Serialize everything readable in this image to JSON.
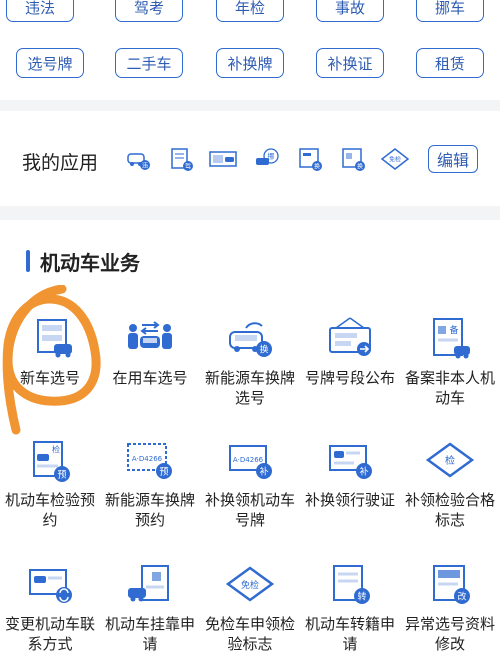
{
  "top_chips": [
    {
      "label": "违法"
    },
    {
      "label": "驾考"
    },
    {
      "label": "年检"
    },
    {
      "label": "事故"
    },
    {
      "label": "挪车"
    },
    {
      "label": "选号牌"
    },
    {
      "label": "二手车"
    },
    {
      "label": "补换牌"
    },
    {
      "label": "补换证"
    },
    {
      "label": "租赁"
    }
  ],
  "my_apps": {
    "label": "我的应用",
    "edit_label": "编辑",
    "mini_icons": [
      {
        "name": "violation-app-icon",
        "badge": "违"
      },
      {
        "name": "license-app-icon",
        "badge": "驾"
      },
      {
        "name": "plate-car-app-icon",
        "badge": ""
      },
      {
        "name": "move-car-app-icon",
        "badge": "挪"
      },
      {
        "name": "plate-replace-app-icon",
        "badge": "换"
      },
      {
        "name": "license-replace-app-icon",
        "badge": "换"
      },
      {
        "name": "exempt-inspection-app-icon",
        "badge": "免检"
      }
    ]
  },
  "business": {
    "title": "机动车业务",
    "tiles": [
      {
        "label": "新车选号",
        "icon": "new-car-plate-icon"
      },
      {
        "label": "在用车选号",
        "icon": "used-car-plate-icon"
      },
      {
        "label": "新能源车换牌选号",
        "icon": "ev-plate-icon",
        "badge": "换"
      },
      {
        "label": "号牌号段公布",
        "icon": "plate-announce-icon"
      },
      {
        "label": "备案非本人机动车",
        "icon": "record-vehicle-icon",
        "badge": "备"
      },
      {
        "label": "机动车检验预约",
        "icon": "inspection-booking-icon",
        "badge": "预",
        "tag": "检"
      },
      {
        "label": "新能源车换牌预约",
        "icon": "ev-plate-booking-icon",
        "badge": "预",
        "plate": "A·D4266"
      },
      {
        "label": "补换领机动车号牌",
        "icon": "replace-plate-icon",
        "badge": "补",
        "plate": "A·D4266"
      },
      {
        "label": "补换领行驶证",
        "icon": "replace-license-icon",
        "badge": "补"
      },
      {
        "label": "补领检验合格标志",
        "icon": "inspection-mark-icon",
        "tag": "检"
      },
      {
        "label": "变更机动车联系方式",
        "icon": "change-contact-icon"
      },
      {
        "label": "机动车挂靠申请",
        "icon": "affiliation-icon"
      },
      {
        "label": "免检车申领检验标志",
        "icon": "exempt-mark-icon",
        "tag": "免检"
      },
      {
        "label": "机动车转籍申请",
        "icon": "transfer-icon",
        "badge": "转"
      },
      {
        "label": "异常选号资料修改",
        "icon": "abnormal-edit-icon",
        "badge": "改"
      }
    ]
  },
  "colors": {
    "accent": "#2f6bd1",
    "annotation": "#f08a1d"
  }
}
